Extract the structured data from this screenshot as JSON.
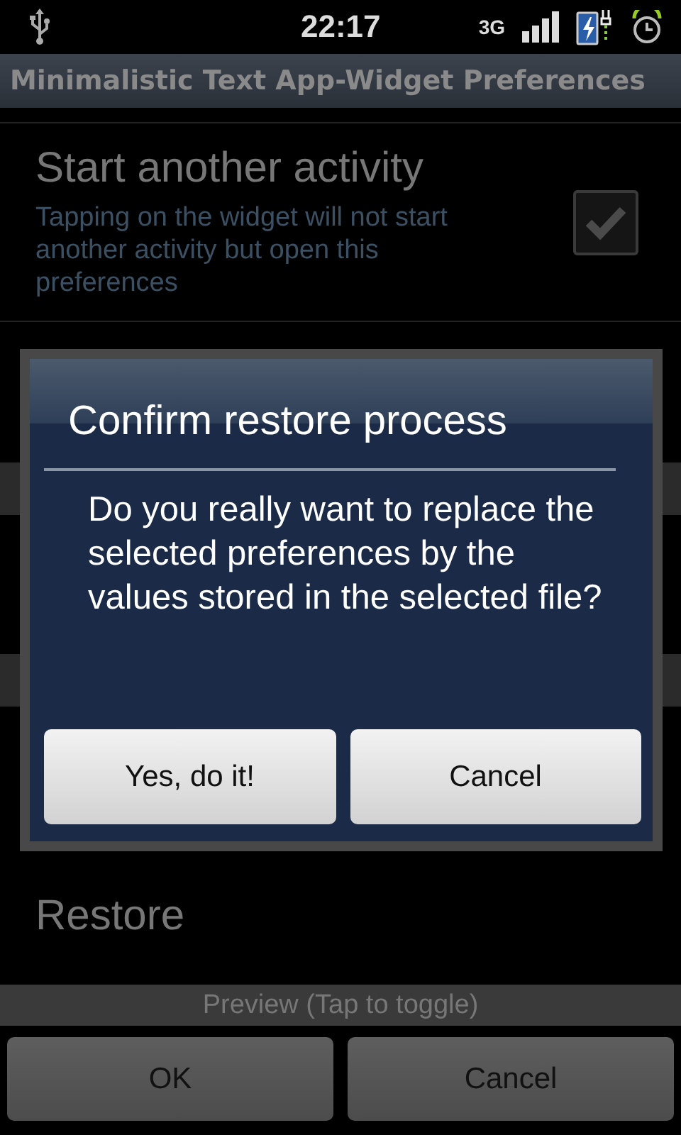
{
  "status_bar": {
    "time": "22:17",
    "network": "3G"
  },
  "title": "Minimalistic Text App-Widget Preferences",
  "preferences": [
    {
      "kind": "checkbox",
      "title": "Start another activity",
      "summary": "Tapping on the widget will not start another activity but open this preferences",
      "checked": true
    },
    {
      "kind": "hidden"
    },
    {
      "kind": "item",
      "title": "Restore"
    }
  ],
  "dialog": {
    "title": "Confirm restore process",
    "message": "Do you really want to replace the selected preferences by the values stored in the selected file?",
    "buttons": [
      "Yes, do it!",
      "Cancel"
    ]
  },
  "preview_bar": "Preview (Tap to toggle)",
  "buttons": [
    "OK",
    "Cancel"
  ]
}
